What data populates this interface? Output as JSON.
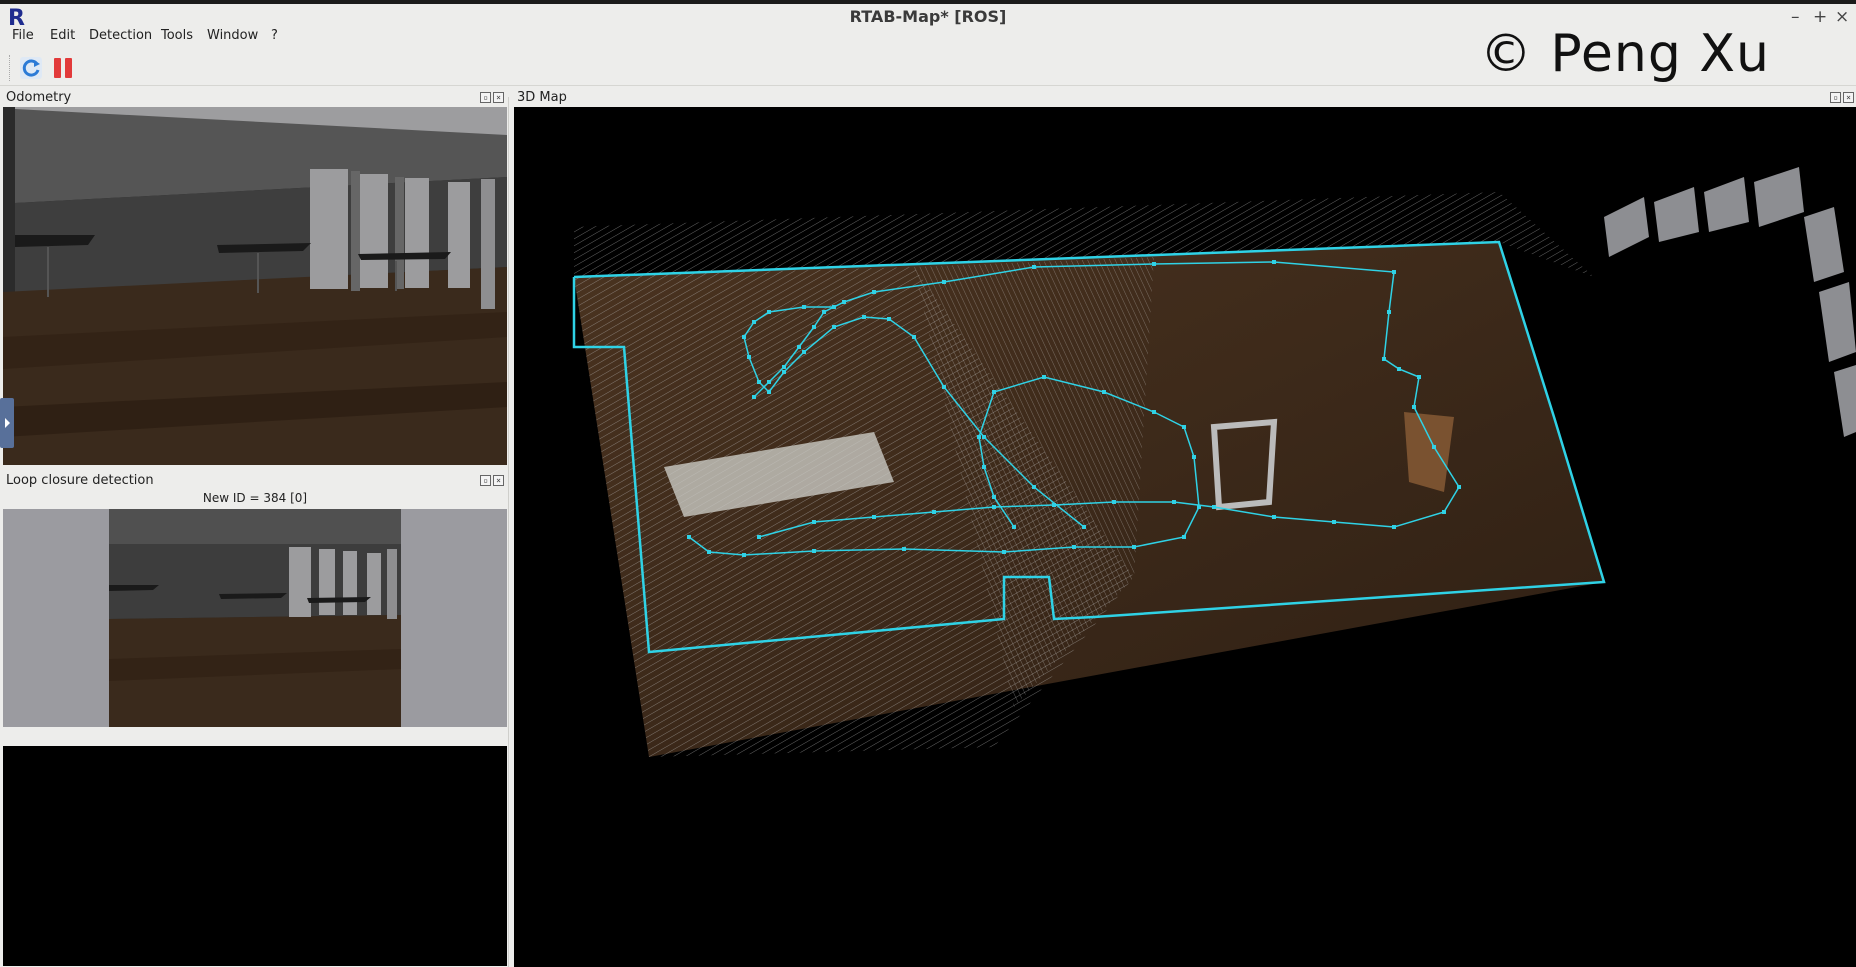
{
  "window": {
    "logo_letter": "R",
    "title": "RTAB-Map* [ROS]",
    "minimize": "–",
    "maximize": "+",
    "close": "×"
  },
  "watermark": "© Peng Xu",
  "menu": [
    "File",
    "Edit",
    "Detection",
    "Tools",
    "Window",
    "?"
  ],
  "toolbar": {
    "buttons": [
      {
        "name": "refresh-icon",
        "color": "#2c7bd6"
      },
      {
        "name": "pause-icon",
        "color": "#e23a3a"
      }
    ]
  },
  "docks": {
    "odometry": {
      "title": "Odometry"
    },
    "loop_closure": {
      "title": "Loop closure detection",
      "status": "New ID = 384 [0]"
    },
    "map3d": {
      "title": "3D Map"
    }
  },
  "colors": {
    "trajectory": "#2fd2e6",
    "floor": "#3b2818",
    "wall_light": "#9a9ba0",
    "background": "#000000"
  }
}
